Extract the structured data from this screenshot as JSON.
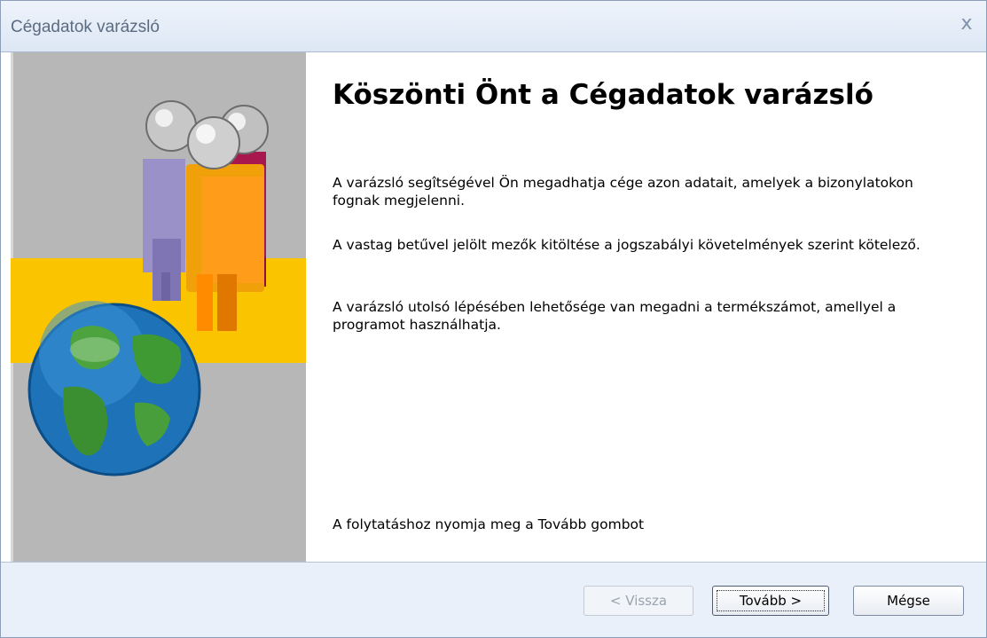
{
  "window": {
    "title": "Cégadatok varázsló",
    "close_glyph": "x"
  },
  "banner": {
    "icons": [
      "people-group-icon",
      "globe-icon"
    ],
    "colors": {
      "background": "#b7b7b7",
      "stripe": "#fbc400"
    }
  },
  "content": {
    "heading": "Köszönti Önt a Cégadatok varázsló",
    "paragraphs": [
      "A varázsló segîtségével Ön megadhatja cége azon adatait, amelyek a bizonylatokon fognak megjelenni.",
      "A vastag betűvel jelölt mezők kitöltése a jogszabályi követelmények szerint kötelező.",
      "A varázsló utolsó lépésében lehetősége van megadni a termékszámot, amellyel a programot használhatja."
    ],
    "footer_hint": "A folytatáshoz nyomja meg a Tovább gombot"
  },
  "buttons": {
    "back": "< Vissza",
    "next": "Tovább >",
    "cancel": "Mégse"
  }
}
